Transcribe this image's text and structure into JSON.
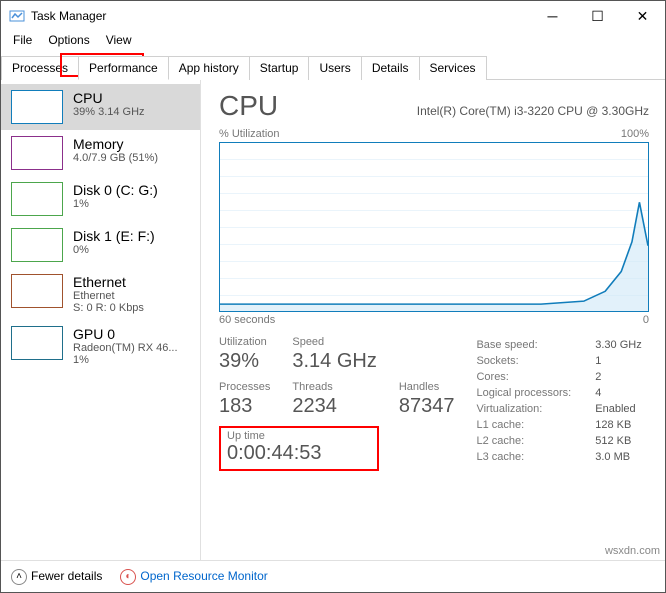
{
  "titlebar": {
    "title": "Task Manager"
  },
  "menu": {
    "file": "File",
    "options": "Options",
    "view": "View"
  },
  "tabs": {
    "processes": "Processes",
    "performance": "Performance",
    "apphistory": "App history",
    "startup": "Startup",
    "users": "Users",
    "details": "Details",
    "services": "Services"
  },
  "sidebar": {
    "items": [
      {
        "name": "CPU",
        "stat": "39% 3.14 GHz",
        "color": "#117dbb"
      },
      {
        "name": "Memory",
        "stat": "4.0/7.9 GB (51%)",
        "color": "#8b2f8b"
      },
      {
        "name": "Disk 0 (C: G:)",
        "stat": "1%",
        "color": "#4ca64c"
      },
      {
        "name": "Disk 1 (E: F:)",
        "stat": "0%",
        "color": "#4ca64c"
      },
      {
        "name": "Ethernet",
        "stat": "Ethernet\nS: 0 R: 0 Kbps",
        "color": "#a0522d"
      },
      {
        "name": "GPU 0",
        "stat": "Radeon(TM) RX 46...\n1%",
        "color": "#1f6f8b"
      }
    ]
  },
  "main": {
    "title": "CPU",
    "desc": "Intel(R) Core(TM) i3-3220 CPU @ 3.30GHz",
    "chart_top_left": "% Utilization",
    "chart_top_right": "100%",
    "chart_bottom_left": "60 seconds",
    "chart_bottom_right": "0",
    "left": {
      "utilization_lbl": "Utilization",
      "utilization": "39%",
      "speed_lbl": "Speed",
      "speed": "3.14 GHz",
      "processes_lbl": "Processes",
      "processes": "183",
      "threads_lbl": "Threads",
      "threads": "2234",
      "handles_lbl": "Handles",
      "handles": "87347",
      "uptime_lbl": "Up time",
      "uptime": "0:00:44:53"
    },
    "right": {
      "basespeed_lbl": "Base speed:",
      "basespeed": "3.30 GHz",
      "sockets_lbl": "Sockets:",
      "sockets": "1",
      "cores_lbl": "Cores:",
      "cores": "2",
      "logical_lbl": "Logical processors:",
      "logical": "4",
      "virt_lbl": "Virtualization:",
      "virt": "Enabled",
      "l1_lbl": "L1 cache:",
      "l1": "128 KB",
      "l2_lbl": "L2 cache:",
      "l2": "512 KB",
      "l3_lbl": "L3 cache:",
      "l3": "3.0 MB"
    }
  },
  "footer": {
    "fewer": "Fewer details",
    "monitor": "Open Resource Monitor"
  },
  "chart_data": {
    "type": "line",
    "title": "% Utilization",
    "xlabel": "60 seconds",
    "ylabel": "% Utilization",
    "xlim": [
      60,
      0
    ],
    "ylim": [
      0,
      100
    ],
    "x": [
      60,
      58,
      56,
      54,
      52,
      50,
      48,
      46,
      44,
      42,
      40,
      38,
      36,
      34,
      32,
      30,
      28,
      26,
      24,
      22,
      20,
      18,
      16,
      14,
      12,
      10,
      8,
      6,
      4,
      2,
      0
    ],
    "values": [
      4,
      4,
      4,
      4,
      3,
      3,
      4,
      4,
      4,
      3,
      3,
      4,
      4,
      4,
      3,
      3,
      4,
      4,
      4,
      4,
      3,
      4,
      5,
      5,
      6,
      8,
      12,
      20,
      35,
      60,
      39
    ]
  },
  "watermark": "wsxdn.com"
}
